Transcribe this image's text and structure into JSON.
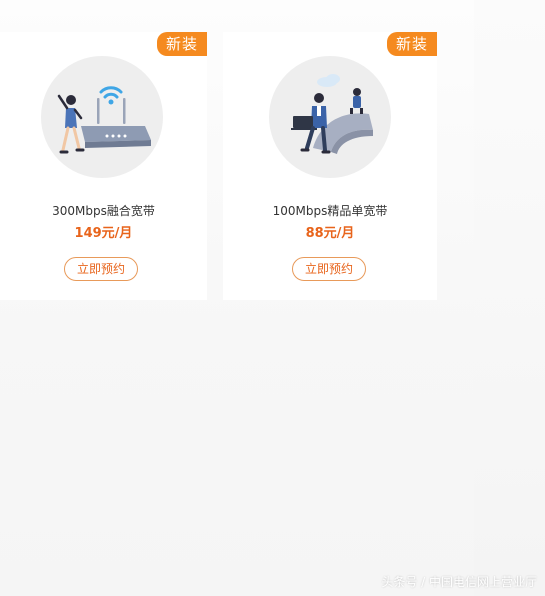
{
  "products": [
    {
      "badge": "新装",
      "name": "300Mbps融合宽带",
      "price": "149元/月",
      "button_label": "立即预约",
      "illustration": "router-wifi-illustration"
    },
    {
      "badge": "新装",
      "name": "100Mbps精品单宽带",
      "price": "88元/月",
      "button_label": "立即预约",
      "illustration": "laptop-user-illustration"
    }
  ],
  "watermark": "头条号 / 中国电信网上营业厅",
  "colors": {
    "accent": "#f58a1f",
    "price": "#e8641b",
    "button_border": "#e89a5a",
    "card": "#ffffff",
    "page": "#f6f6f6"
  }
}
